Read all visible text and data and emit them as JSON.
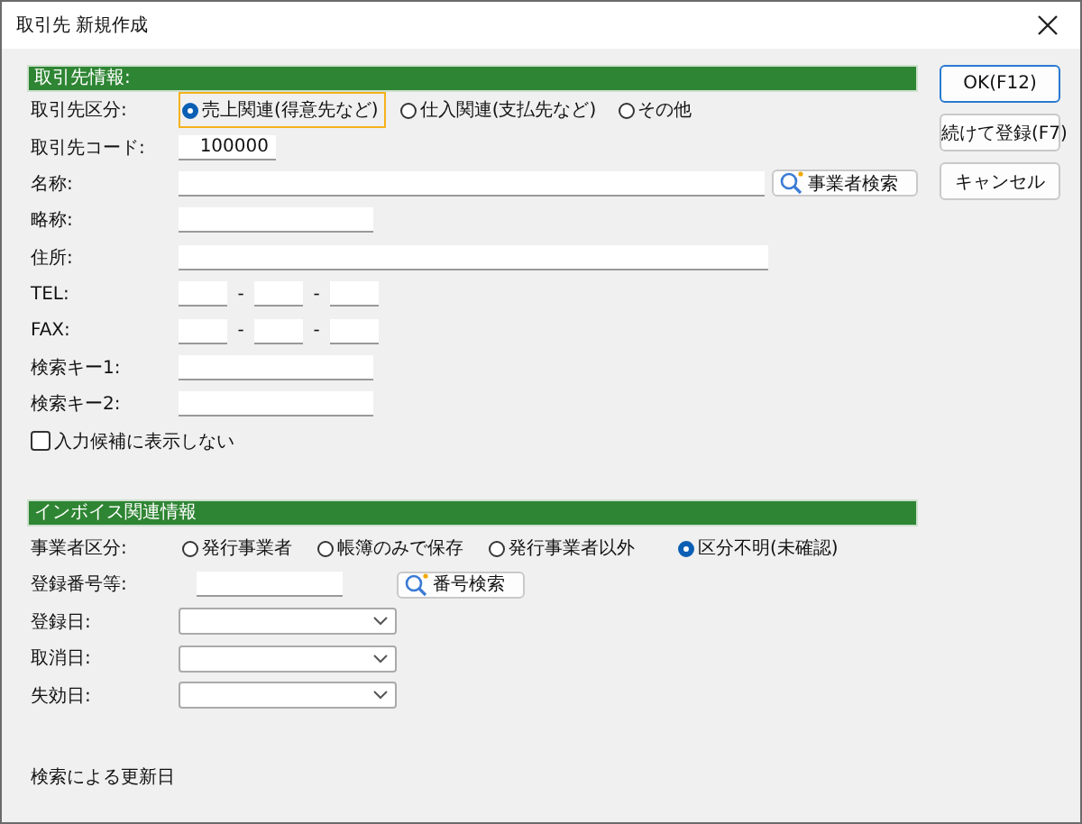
{
  "window": {
    "title": "取引先 新規作成"
  },
  "partner": {
    "heading": "取引先情報:",
    "category": {
      "label": "取引先区分:",
      "options": [
        {
          "label": "売上関連(得意先など)",
          "selected": true,
          "focused": true
        },
        {
          "label": "仕入関連(支払先など)",
          "selected": false,
          "focused": false
        },
        {
          "label": "その他",
          "selected": false,
          "focused": false
        }
      ]
    },
    "code": {
      "label": "取引先コード:",
      "value": "100000"
    },
    "name": {
      "label": "名称:"
    },
    "name_search_button": "事業者検索",
    "short_name": {
      "label": "略称:"
    },
    "address": {
      "label": "住所:"
    },
    "tel": {
      "label": "TEL:",
      "separators": [
        "-",
        "-"
      ]
    },
    "fax": {
      "label": "FAX:",
      "separators": [
        "-",
        "-"
      ]
    },
    "search_key_1": {
      "label": "検索キー1:"
    },
    "search_key_2": {
      "label": "検索キー2:"
    },
    "hide_checkbox": {
      "label": "入力候補に表示しない",
      "checked": false
    }
  },
  "invoice": {
    "heading": "インボイス関連情報",
    "business_type": {
      "label": "事業者区分:",
      "options": [
        {
          "label": "発行事業者",
          "selected": false,
          "focused": false
        },
        {
          "label": "帳簿のみで保存",
          "selected": false,
          "focused": false
        },
        {
          "label": "発行事業者以外",
          "selected": false,
          "focused": false
        },
        {
          "label": "区分不明(未確認)",
          "selected": true,
          "focused": false
        }
      ]
    },
    "registration_number": {
      "label": "登録番号等:"
    },
    "number_search_button": "番号検索",
    "dates": [
      {
        "label": "登録日:"
      },
      {
        "label": "取消日:"
      },
      {
        "label": "失効日:"
      }
    ],
    "updated_label": "検索による更新日"
  },
  "buttons": [
    {
      "label": "OK(F12)",
      "default": true
    },
    {
      "label": "続けて登録(F7)",
      "default": false
    },
    {
      "label": "キャンセル",
      "default": false
    }
  ]
}
